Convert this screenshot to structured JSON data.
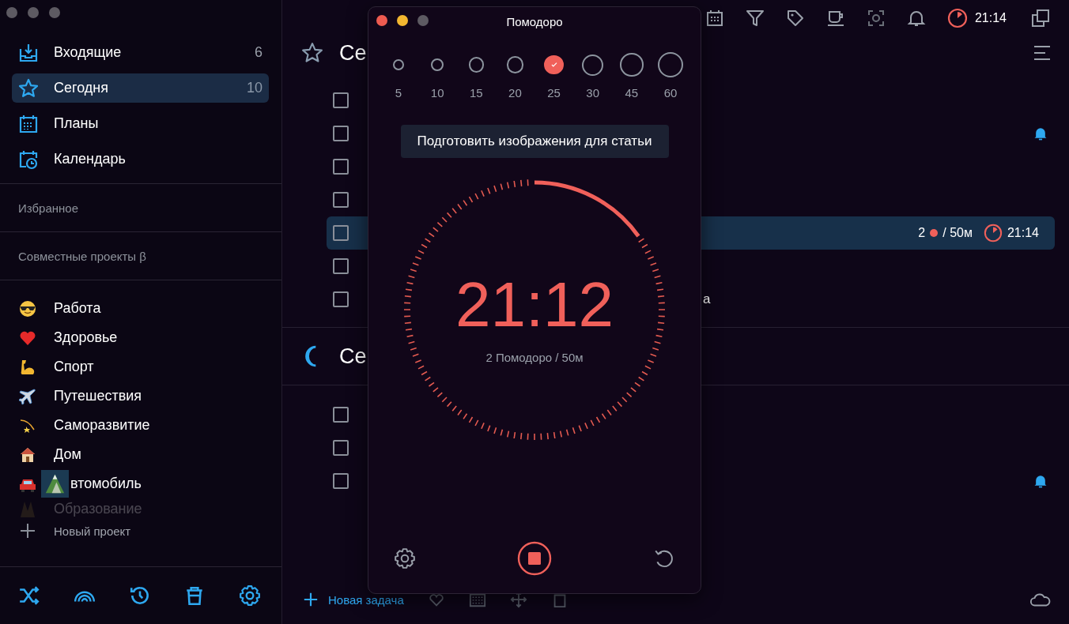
{
  "sidebar": {
    "nav": [
      {
        "kind": "inbox",
        "label": "Входящие",
        "count": "6",
        "selected": false
      },
      {
        "kind": "star",
        "label": "Сегодня",
        "count": "10",
        "selected": true
      },
      {
        "kind": "calendar",
        "label": "Планы",
        "selected": false
      },
      {
        "kind": "calendar-clock",
        "label": "Календарь",
        "selected": false
      }
    ],
    "groups": [
      "Избранное",
      "Совместные проекты β"
    ],
    "projects": [
      {
        "kind": "sunglasses",
        "label": "Работа"
      },
      {
        "kind": "heart",
        "label": "Здоровье"
      },
      {
        "kind": "arm",
        "label": "Спорт"
      },
      {
        "kind": "plane",
        "label": "Путешествия"
      },
      {
        "kind": "shooting-star",
        "label": "Саморазвитие"
      },
      {
        "kind": "house",
        "label": "Дом"
      },
      {
        "kind": "car",
        "label": "втомобиль",
        "dragged": true
      },
      {
        "kind": "faded",
        "label": "Образование",
        "faded": true
      }
    ],
    "new_project": "Новый проект"
  },
  "toolbar": {
    "timer": "21:14"
  },
  "sections": [
    {
      "kind": "today",
      "title": "Се",
      "tasks": [
        {
          "checked": false,
          "selected": false
        },
        {
          "checked": false,
          "selected": false,
          "bell": true
        },
        {
          "checked": false,
          "selected": false
        },
        {
          "checked": false,
          "selected": false
        },
        {
          "checked": false,
          "selected": true,
          "pomodoros": "2",
          "duration": "/ 50м",
          "time": "21:14"
        },
        {
          "checked": false,
          "selected": false
        },
        {
          "checked": false,
          "selected": false,
          "text": "а"
        }
      ]
    },
    {
      "kind": "evening",
      "title": "Се",
      "tasks": [
        {
          "checked": false,
          "selected": false
        },
        {
          "checked": false,
          "selected": false
        },
        {
          "checked": false,
          "selected": false,
          "bell": true
        }
      ]
    }
  ],
  "new_task": "Новая задача",
  "pomodoro": {
    "title": "Помодоро",
    "durations": [
      {
        "label": "5",
        "selected": false
      },
      {
        "label": "10",
        "selected": false
      },
      {
        "label": "15",
        "selected": false
      },
      {
        "label": "20",
        "selected": false
      },
      {
        "label": "25",
        "selected": true
      },
      {
        "label": "30",
        "selected": false
      },
      {
        "label": "45",
        "selected": false
      },
      {
        "label": "60",
        "selected": false
      }
    ],
    "task": "Подготовить изображения для статьи",
    "level": 0.152,
    "time": "21:12",
    "summary": "2 Помодоро / 50м"
  }
}
